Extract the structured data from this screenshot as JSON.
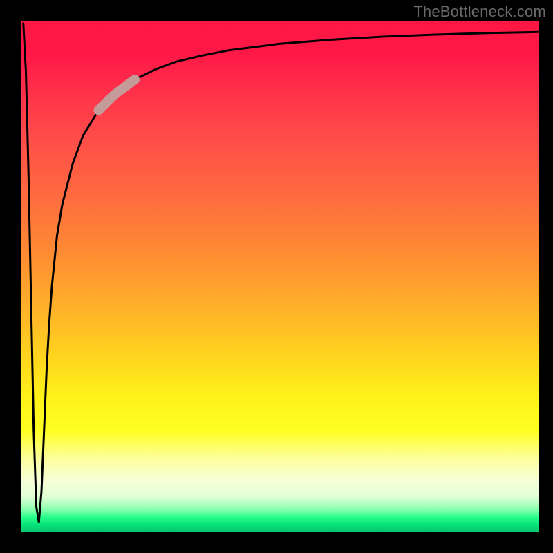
{
  "watermark": "TheBottleneck.com",
  "chart_data": {
    "type": "line",
    "title": "",
    "xlabel": "",
    "ylabel": "",
    "xlim": [
      0,
      100
    ],
    "ylim": [
      0,
      100
    ],
    "grid": false,
    "legend": false,
    "annotations": [],
    "series": [
      {
        "name": "curve",
        "x": [
          0.5,
          1.0,
          1.5,
          2.0,
          2.5,
          3.0,
          3.5,
          4.0,
          4.5,
          5.0,
          5.5,
          6.0,
          7.0,
          8.0,
          10.0,
          12.0,
          15.0,
          18.0,
          22.0,
          26.0,
          30.0,
          35.0,
          40.0,
          50.0,
          60.0,
          70.0,
          80.0,
          90.0,
          100.0
        ],
        "y": [
          99.5,
          90.0,
          70.0,
          45.0,
          20.0,
          5.0,
          2.0,
          8.0,
          20.0,
          32.0,
          41.0,
          48.0,
          58.0,
          64.0,
          72.0,
          77.5,
          82.5,
          85.5,
          88.5,
          90.5,
          92.0,
          93.2,
          94.2,
          95.5,
          96.3,
          96.9,
          97.3,
          97.6,
          97.8
        ]
      }
    ],
    "accent_segment": {
      "series": "curve",
      "x_range": [
        15,
        22
      ],
      "color": "#c49b98",
      "width": 14
    },
    "background_gradient": {
      "direction": "vertical",
      "stops": [
        {
          "t": 0.0,
          "color": "#ff1744"
        },
        {
          "t": 0.35,
          "color": "#ff7a33"
        },
        {
          "t": 0.7,
          "color": "#ffe91a"
        },
        {
          "t": 0.9,
          "color": "#f0ffd0"
        },
        {
          "t": 1.0,
          "color": "#05c46b"
        }
      ]
    }
  },
  "colors": {
    "frame": "#000000",
    "curve": "#000000",
    "accent": "#c49b98",
    "watermark": "#6a6a6a"
  }
}
